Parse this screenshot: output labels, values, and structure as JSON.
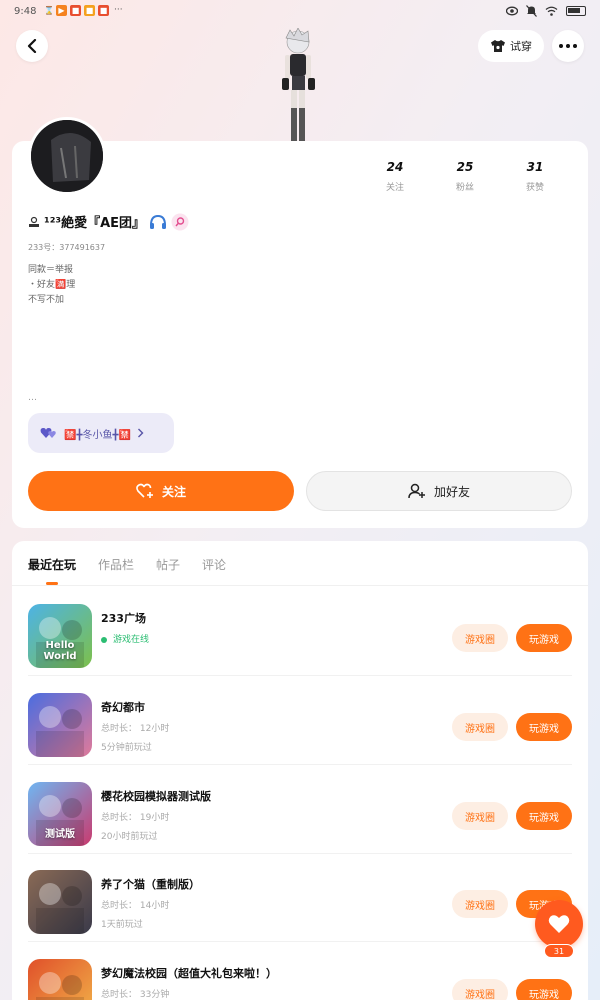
{
  "status_bar": {
    "time": "9:48",
    "app_icons": [
      {
        "name": "hourglass-icon",
        "glyph": "⌛",
        "color": "#666"
      },
      {
        "name": "app-icon-1",
        "glyph": "▶",
        "color": "#f5821f"
      },
      {
        "name": "app-icon-2",
        "glyph": "■",
        "color": "#e84e2f"
      },
      {
        "name": "app-icon-3",
        "glyph": "■",
        "color": "#f4a11e"
      },
      {
        "name": "app-icon-4",
        "glyph": "■",
        "color": "#e84e2f"
      }
    ],
    "more": "···"
  },
  "header": {
    "back_glyph": "‹",
    "tryon_label": "试穿",
    "more_glyph": "•••"
  },
  "profile": {
    "stats": [
      {
        "value": "24",
        "label": "关注"
      },
      {
        "value": "25",
        "label": "粉丝"
      },
      {
        "value": "31",
        "label": "获赞"
      }
    ],
    "nickname": "¹²³絶愛『AE团』",
    "uid": "233号：377491637",
    "bio": "同款＝举报\n・好友🈵理\n不写不加",
    "ellipsis": "…",
    "fan_pill_label": "🈲╋冬小鱼╋🈲",
    "follow_label": "关注",
    "add_friend_label": "加好友"
  },
  "tabs": [
    "最近在玩",
    "作品栏",
    "帖子",
    "评论"
  ],
  "games": [
    {
      "name": "233广场",
      "meta1": "游戏在线",
      "meta2": "",
      "online": true,
      "circle": "游戏圈",
      "play": "玩游戏",
      "icon_colors": [
        "#4db3e6",
        "#7dc04a"
      ],
      "icon_text": "Hello World"
    },
    {
      "name": "奇幻都市",
      "meta1": "总时长： 12小时",
      "meta2": "5分钟前玩过",
      "online": false,
      "circle": "游戏圈",
      "play": "玩游戏",
      "icon_colors": [
        "#4a6de0",
        "#e07a9a"
      ],
      "icon_text": ""
    },
    {
      "name": "樱花校园模拟器测试版",
      "meta1": "总时长： 19小时",
      "meta2": "20小时前玩过",
      "online": false,
      "circle": "游戏圈",
      "play": "玩游戏",
      "icon_colors": [
        "#6fb6f2",
        "#c93a6e"
      ],
      "icon_text": "测试版"
    },
    {
      "name": "养了个猫（重制版）",
      "meta1": "总时长： 14小时",
      "meta2": "1天前玩过",
      "online": false,
      "circle": "游戏圈",
      "play": "玩游戏",
      "icon_colors": [
        "#8a6a55",
        "#3a3a4a"
      ],
      "icon_text": ""
    },
    {
      "name": "梦幻魔法校园（超值大礼包来啦！）",
      "meta1": "总时长： 33分钟",
      "meta2": "",
      "online": false,
      "circle": "游戏圈",
      "play": "玩游戏",
      "icon_colors": [
        "#e0502a",
        "#f2b54a"
      ],
      "icon_text": ""
    }
  ],
  "floating": {
    "count": "31"
  },
  "colors": {
    "accent": "#ff7215",
    "online": "#2bbd72"
  }
}
